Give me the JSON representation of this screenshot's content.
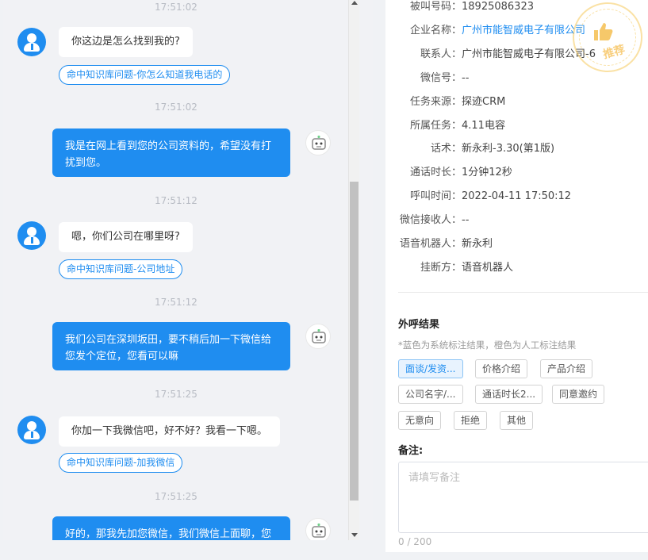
{
  "chat": {
    "messages": [
      {
        "time": "17:51:02",
        "role": "user",
        "text": "你这边是怎么找到我的?",
        "kb_tag": "命中知识库问题-你怎么知道我电话的"
      },
      {
        "time": "17:51:02",
        "role": "bot",
        "line1": "我是在网上看到您的公司资料的，希望没有打",
        "line2": "扰到您。"
      },
      {
        "time": "17:51:12",
        "role": "user",
        "text": "嗯，你们公司在哪里呀?",
        "kb_tag": "命中知识库问题-公司地址"
      },
      {
        "time": "17:51:12",
        "role": "bot",
        "line1": "我们公司在深圳坂田，要不稍后加一下微信给",
        "line2": "您发个定位，您看可以嘛"
      },
      {
        "time": "17:51:25",
        "role": "user",
        "text": "你加一下我微信吧，好不好？我看一下嗯。",
        "kb_tag": "命中知识库问题-加我微信"
      },
      {
        "time": "17:51:25",
        "role": "bot",
        "line1": "好的，那我先加您微信，我们微信上面聊，您"
      }
    ]
  },
  "details": {
    "rows": [
      {
        "label": "被叫号码：",
        "value": "18925086323",
        "link": false
      },
      {
        "label": "企业名称：",
        "value": "广州市能智威电子有限公司",
        "link": true
      },
      {
        "label": "联系人：",
        "value": "广州市能智威电子有限公司-6",
        "link": false
      },
      {
        "label": "微信号：",
        "value": "--",
        "link": false
      },
      {
        "label": "任务来源：",
        "value": "探迹CRM",
        "link": false
      },
      {
        "label": "所属任务：",
        "value": "4.11电容",
        "link": false
      },
      {
        "label": "话术：",
        "value": "新永利-3.30(第1版)",
        "link": false
      },
      {
        "label": "通话时长：",
        "value": "1分钟12秒",
        "link": false
      },
      {
        "label": "呼叫时间：",
        "value": "2022-04-11 17:50:12",
        "link": false
      },
      {
        "label": "微信接收人：",
        "value": "--",
        "link": false
      },
      {
        "label": "语音机器人：",
        "value": "新永利",
        "link": false
      },
      {
        "label": "挂断方：",
        "value": "语音机器人",
        "link": false
      }
    ],
    "stamp_text": "推荐",
    "result_title": "外呼结果",
    "result_note": "*蓝色为系统标注结果，橙色为人工标注结果",
    "tags": [
      "面谈/发资...",
      "价格介绍",
      "产品介绍",
      "公司名字/...",
      "通话时长2...",
      "同意邀约",
      "无意向",
      "拒绝",
      "其他"
    ],
    "remark_label": "备注:",
    "remark_placeholder": "请填写备注",
    "char_count": "0 / 200"
  },
  "colors": {
    "accent": "#1f8df0",
    "stamp": "#f5c85a"
  }
}
